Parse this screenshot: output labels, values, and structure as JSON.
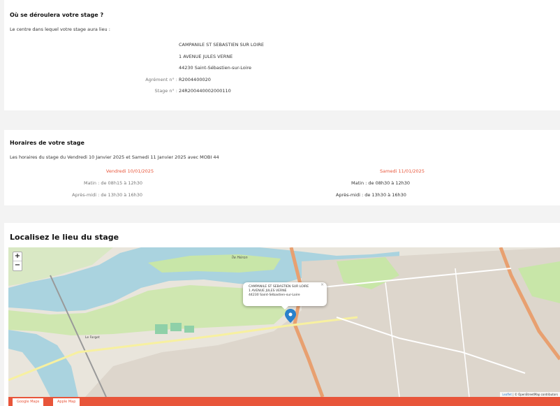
{
  "stage_location": {
    "title": "Où se déroulera votre stage ?",
    "intro": "Le centre dans lequel votre stage aura lieu :",
    "center_name": "CAMPANILE ST SEBASTIEN SUR LOIRE",
    "address1": "1 AVENUE JULES VERNE",
    "address2": "44230 Saint-Sébastien-sur-Loire",
    "agrement_label": "Agrément n° :",
    "agrement_value": "R2004400020",
    "stage_label": "Stage n° :",
    "stage_value": "24R200440002000110"
  },
  "schedule": {
    "title": "Horaires de votre stage",
    "intro": "Les horaires du stage du Vendredi 10 Janvier 2025 et Samedi 11 Janvier 2025 avec MOBI 44",
    "days": [
      {
        "date": "Vendredi 10/01/2025",
        "morning": "Matin : de 08h15 à 12h30",
        "afternoon": "Après-midi : de 13h30 à 16h30"
      },
      {
        "date": "Samedi 11/01/2025",
        "morning": "Matin : de 08h30 à 12h30",
        "afternoon": "Après-midi : de 13h30 à 16h30"
      }
    ]
  },
  "map_section": {
    "title": "Localisez le lieu du stage",
    "zoom_in": "+",
    "zoom_out": "−",
    "popup": {
      "line1": "CAMPANILE ST SEBASTIEN SUR LOIRE",
      "line2": "1 AVENUE JULES VERNE",
      "line3": "44230 Saint-Sébastien-sur-Loire",
      "close": "×"
    },
    "attribution_leaflet": "Leaflet",
    "attribution_osm": "© OpenStreetMap contributors",
    "labels": {
      "ile_heron": "Île Héron",
      "le_farget": "Le Farget"
    },
    "buttons": {
      "google": "Google Maps",
      "apple": "Apple Map"
    },
    "colors": {
      "accent": "#e8553a",
      "water": "#aad3df",
      "park": "#c8e6a8",
      "marker": "#2a81cb"
    }
  }
}
